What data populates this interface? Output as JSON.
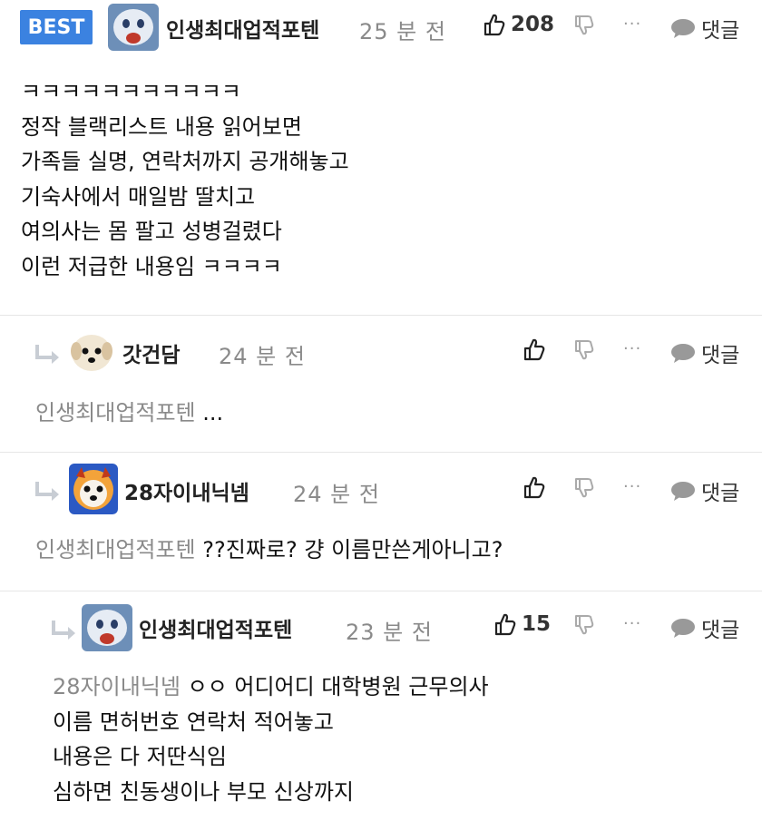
{
  "ui": {
    "best_badge": "BEST",
    "reply_label": "댓글",
    "more_label": "···"
  },
  "comments": [
    {
      "author": "인생최대업적포텐",
      "time": "25 분 전",
      "likes": "208",
      "lines": [
        "ㅋㅋㅋㅋㅋㅋㅋㅋㅋㅋㅋ",
        "정작 블랙리스트 내용 읽어보면",
        "가족들 실명, 연락처까지 공개해놓고",
        "기숙사에서 매일밤 딸치고",
        "여의사는 몸 팔고 성병걸렸다",
        "이런 저급한 내용임 ㅋㅋㅋㅋ"
      ]
    },
    {
      "author": "갓건담",
      "time": "24 분 전",
      "likes": "",
      "mention": "인생최대업적포텐",
      "text": "..."
    },
    {
      "author": "28자이내닉넴",
      "time": "24 분 전",
      "likes": "",
      "mention": "인생최대업적포텐",
      "text": "??진짜로? 걍 이름만쓴게아니고?"
    },
    {
      "author": "인생최대업적포텐",
      "time": "23 분 전",
      "likes": "15",
      "mention": "28자이내닉넴",
      "lines": [
        "ㅇㅇ 어디어디 대학병원 근무의사",
        "이름 면허번호 연락처 적어놓고",
        "내용은 다 저딴식임",
        "심하면 친동생이나 부모 신상까지"
      ]
    }
  ]
}
